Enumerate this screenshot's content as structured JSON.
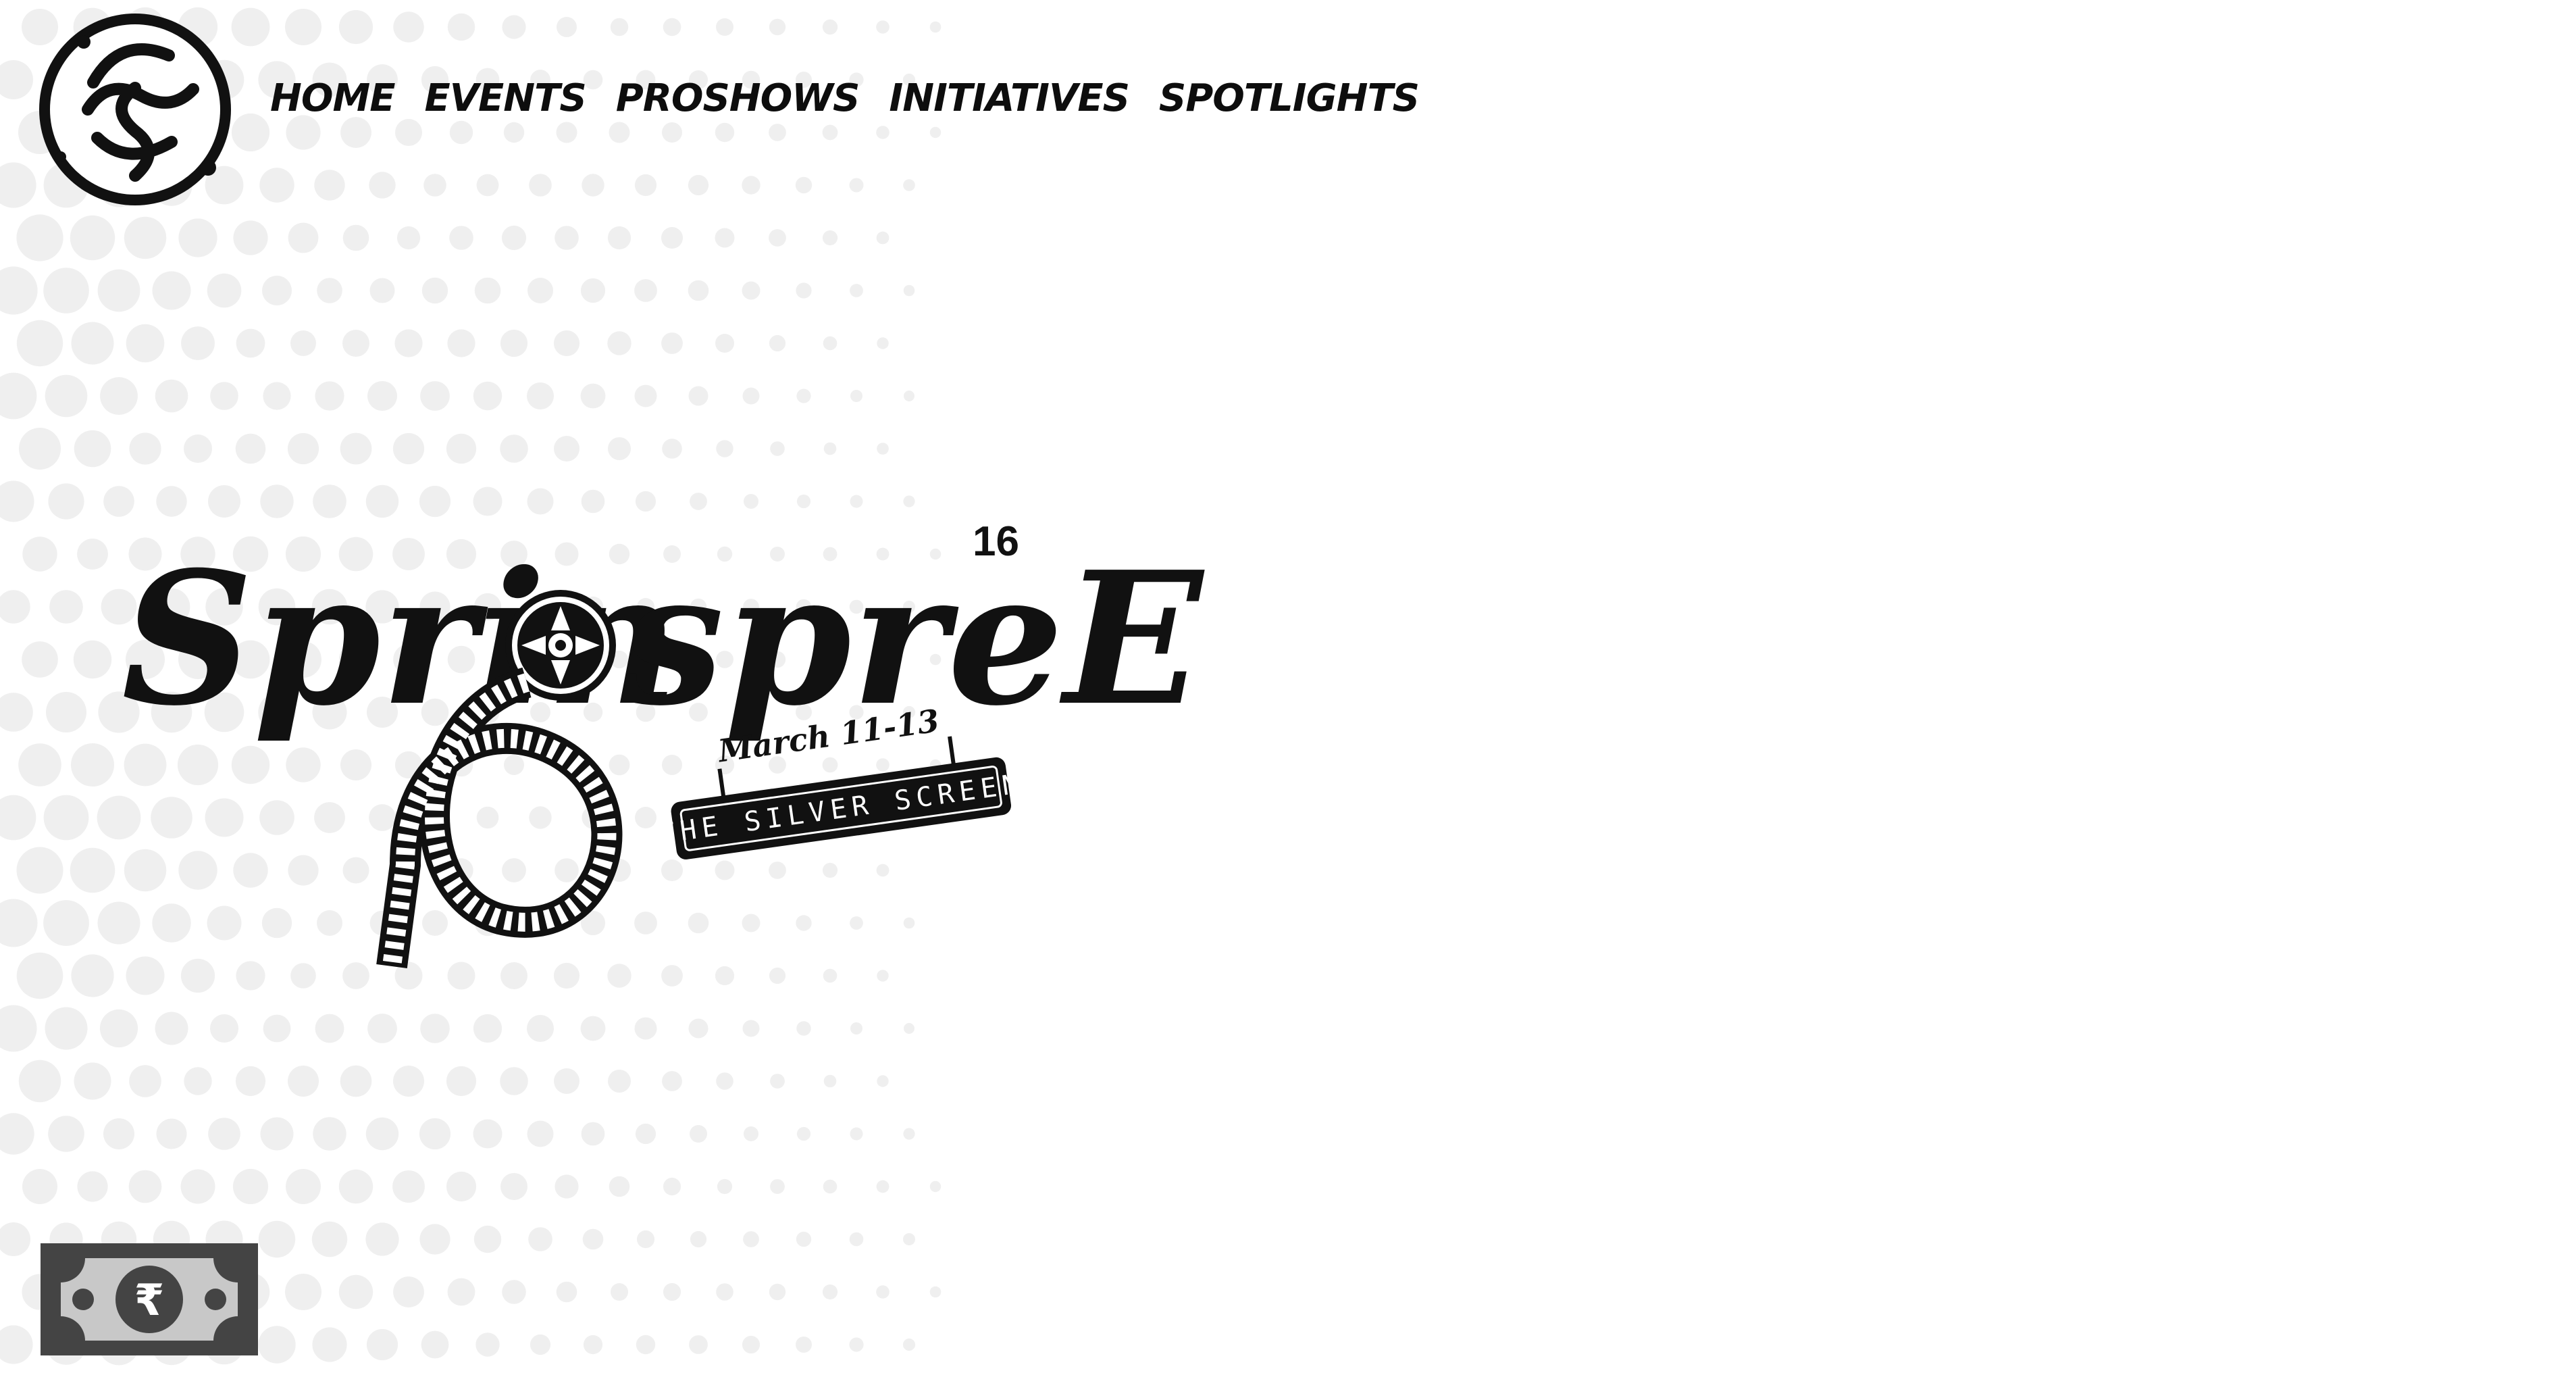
{
  "nav": {
    "items": [
      {
        "label": "HOME"
      },
      {
        "label": "EVENTS"
      },
      {
        "label": "PROSHOWS"
      },
      {
        "label": "INITIATIVES"
      },
      {
        "label": "SPOTLIGHTS"
      }
    ]
  },
  "hero": {
    "title_left": "Sprin",
    "title_right": "spreE",
    "edition": "16",
    "dates": "March 11-13",
    "theme": "THE SILVER SCREEN"
  },
  "footer_widget": {
    "currency_symbol": "₹",
    "icon": "currency-note-icon"
  },
  "colors": {
    "text": "#0d0d0d",
    "dots": "#eeeeee",
    "note_outer": "#444444",
    "note_inner": "#c8c8c8"
  }
}
